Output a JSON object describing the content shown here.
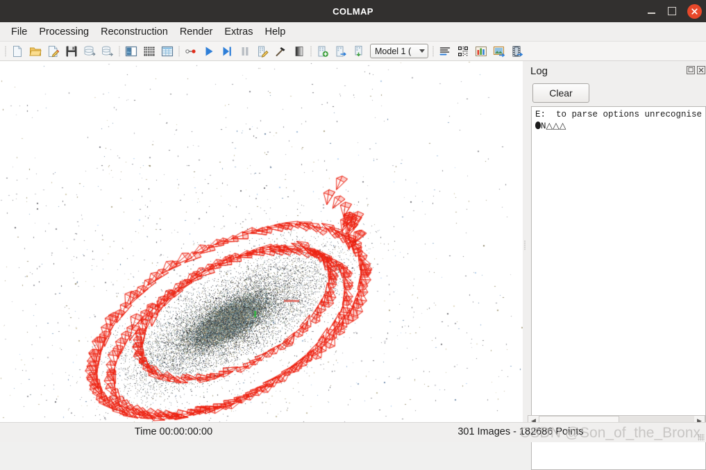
{
  "window": {
    "title": "COLMAP",
    "minimize_label": "_",
    "maximize_label": "□",
    "close_label": "✕"
  },
  "menubar": {
    "items": [
      {
        "label": "File"
      },
      {
        "label": "Processing"
      },
      {
        "label": "Reconstruction"
      },
      {
        "label": "Render"
      },
      {
        "label": "Extras"
      },
      {
        "label": "Help"
      }
    ]
  },
  "toolbar": {
    "model_selector": {
      "value": "Model 1 (",
      "icon": "chevron-down-icon"
    },
    "buttons": [
      {
        "name": "new-project-button",
        "icon": "new-document-icon"
      },
      {
        "name": "open-project-button",
        "icon": "open-folder-icon"
      },
      {
        "name": "edit-project-button",
        "icon": "edit-document-icon"
      },
      {
        "name": "save-project-button",
        "icon": "floppy-disk-icon"
      },
      {
        "name": "import-model-button",
        "icon": "import-database-icon"
      },
      {
        "name": "export-model-button",
        "icon": "export-database-icon"
      },
      {
        "name": "feature-extraction-button",
        "icon": "image-panel-icon"
      },
      {
        "name": "feature-matching-button",
        "icon": "grid-matrix-icon"
      },
      {
        "name": "database-management-button",
        "icon": "table-window-icon"
      },
      {
        "name": "automatic-reconstruction-button",
        "icon": "node-link-icon"
      },
      {
        "name": "start-reconstruction-button",
        "icon": "play-icon"
      },
      {
        "name": "reconstruct-next-image-button",
        "icon": "skip-next-icon"
      },
      {
        "name": "pause-reconstruction-button",
        "icon": "pause-icon"
      },
      {
        "name": "bundle-adjustment-button",
        "icon": "edit-building-icon"
      },
      {
        "name": "dense-reconstruction-button",
        "icon": "hammer-icon"
      },
      {
        "name": "render-options-button",
        "icon": "gradient-square-icon"
      },
      {
        "name": "add-model-button",
        "icon": "building-add-icon"
      },
      {
        "name": "transfer-model-button",
        "icon": "building-transfer-icon"
      },
      {
        "name": "save-model-button",
        "icon": "building-download-icon"
      },
      {
        "name": "show-log-button",
        "icon": "text-lines-icon"
      },
      {
        "name": "match-matrix-button",
        "icon": "qr-code-icon"
      },
      {
        "name": "model-statistics-button",
        "icon": "bar-chart-icon"
      },
      {
        "name": "show-images-button",
        "icon": "photo-export-icon"
      },
      {
        "name": "grab-movie-button",
        "icon": "film-strip-icon"
      }
    ]
  },
  "log_panel": {
    "title": "Log",
    "float_icon": "undock-icon",
    "close_icon": "close-icon",
    "clear_button": "Clear",
    "lines": [
      "E:  to parse options unrecognise",
      "N△△△"
    ],
    "hscroll": {
      "left_arrow": "◀",
      "right_arrow": "▶"
    }
  },
  "viewport": {
    "name": "model-viewer",
    "background_color": "#ffffff",
    "camera_frustum_color": "#ee2211"
  },
  "statusbar": {
    "time": "Time 00:00:00:00",
    "counts": "301 Images - 182686 Points"
  },
  "watermark": {
    "text": "CSDN @Son_of_the_Bronx"
  }
}
